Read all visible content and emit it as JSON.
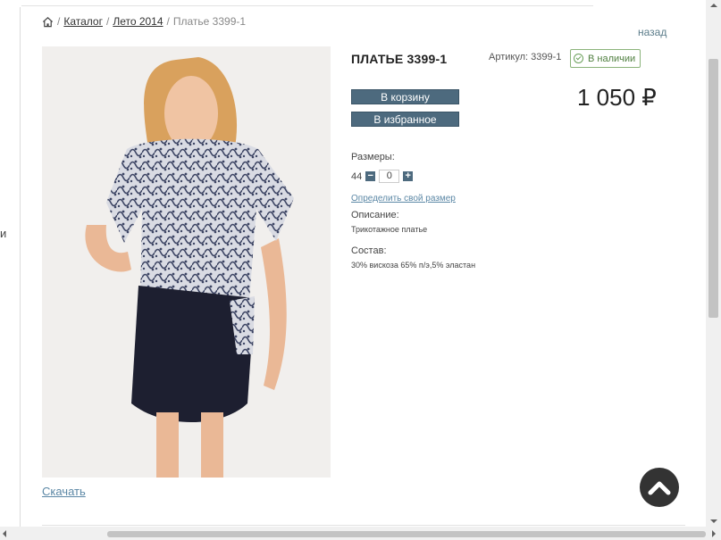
{
  "breadcrumb": {
    "home_icon": "home-icon",
    "items": [
      "Каталог",
      "Лето 2014"
    ],
    "current": "Платье 3399-1"
  },
  "back_link": "назад",
  "product": {
    "title": "ПЛАТЬЕ 3399-1",
    "article": "Артикул: 3399-1",
    "stock": "В наличии",
    "price": "1 050 ₽",
    "add_to_cart": "В корзину",
    "add_to_favorites": "В избранное",
    "sizes_label": "Размеры:",
    "size": "44",
    "quantity": "0",
    "size_link": "Определить свой размер",
    "description_label": "Описание:",
    "description": "Трикотажное платье",
    "composition_label": "Состав:",
    "composition": "30% вискоза 65% п/э,5% эластан"
  },
  "download_link": "Скачать",
  "left_fragment": "и",
  "colors": {
    "button": "#4d6a7e",
    "stock_green": "#4f7f3f",
    "link": "#5b87a5"
  }
}
